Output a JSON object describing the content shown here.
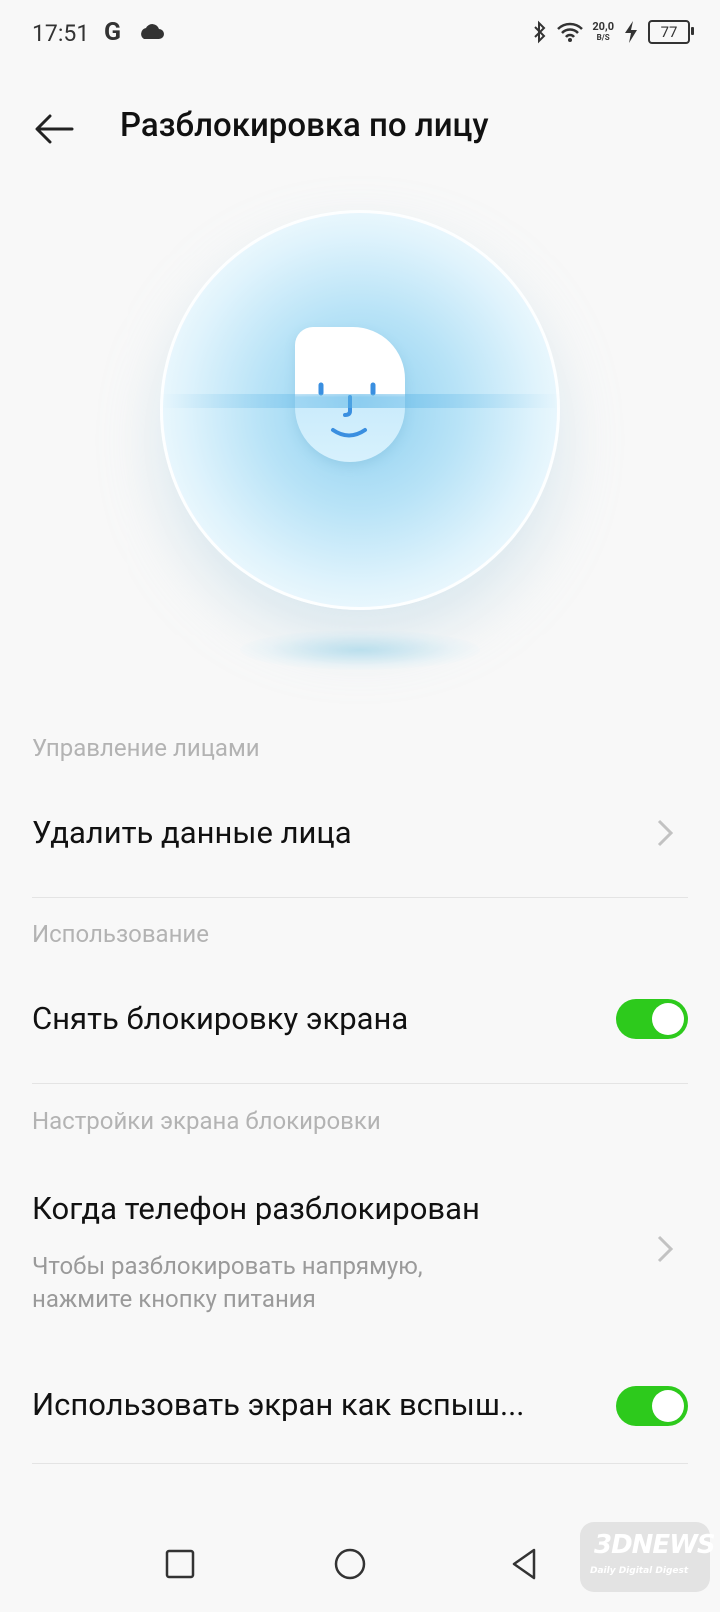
{
  "status": {
    "time": "17:51",
    "g_icon": "google-icon",
    "cloud_icon": "cloud-icon",
    "speed_value": "20,0",
    "speed_unit": "B/S",
    "battery": "77"
  },
  "header": {
    "title": "Разблокировка по лицу",
    "back_icon": "arrow-left-icon"
  },
  "sections": {
    "face_management": "Управление лицами",
    "usage": "Использование",
    "lock_screen_settings": "Настройки экрана блокировки"
  },
  "rows": {
    "delete_face": {
      "title": "Удалить данные лица"
    },
    "unlock_screen": {
      "title": "Снять блокировку экрана",
      "enabled": true
    },
    "when_unlocked": {
      "title": "Когда телефон разблокирован",
      "subtitle_line1": "Чтобы разблокировать напрямую,",
      "subtitle_line2": "нажмите кнопку питания"
    },
    "use_screen_flash": {
      "title": "Использовать экран как вспыш...",
      "enabled": true
    }
  },
  "watermark": {
    "brand": "3DNEWS",
    "tagline": "Daily Digital Digest"
  },
  "colors": {
    "toggle_on": "#2dca1c",
    "background": "#f8f8f8"
  }
}
